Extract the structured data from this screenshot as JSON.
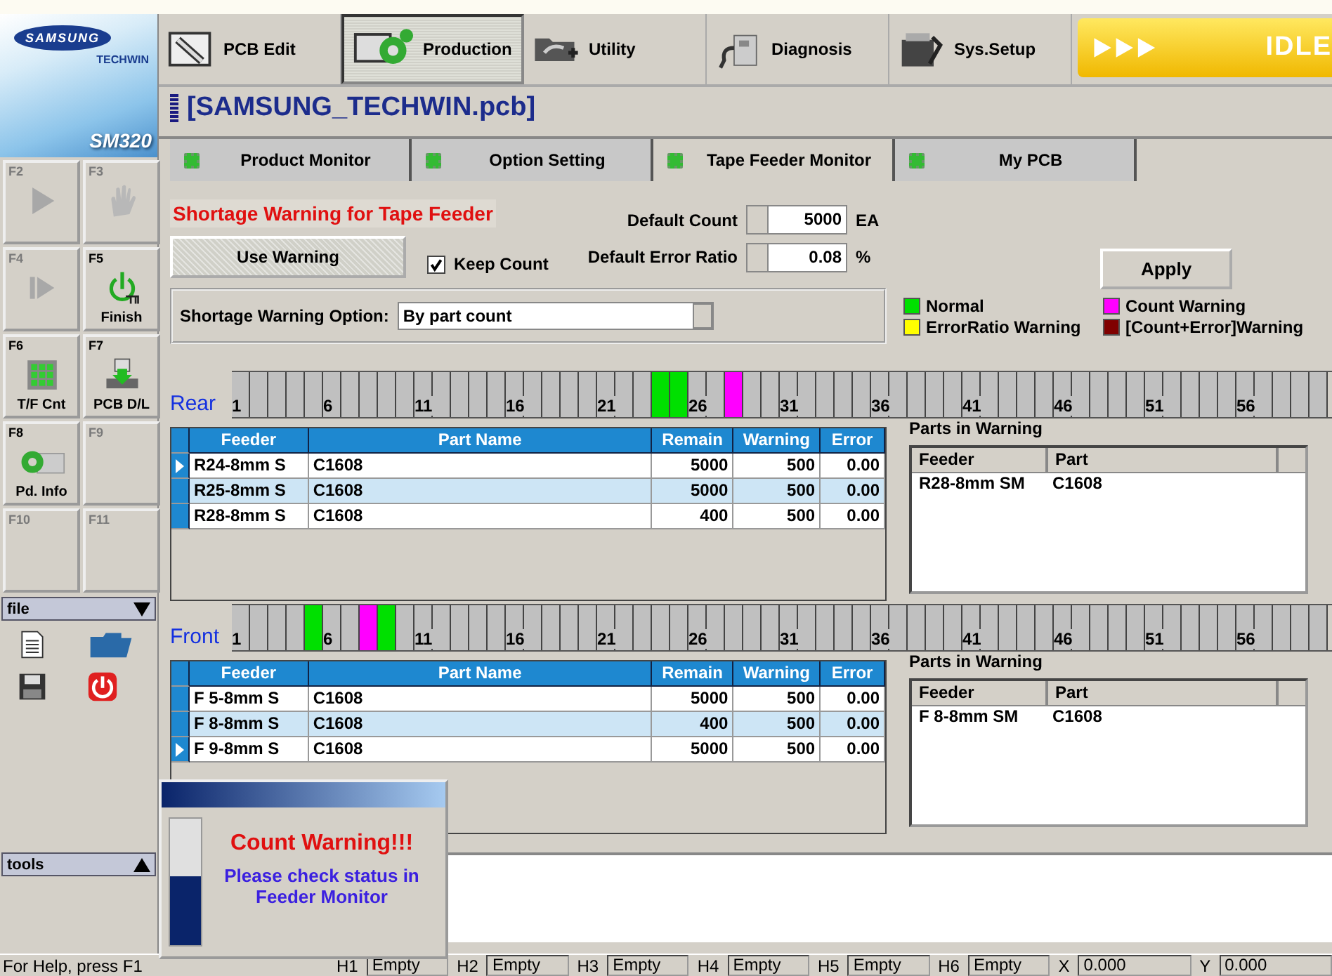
{
  "logo": {
    "brand": "SAMSUNG",
    "sub": "TECHWIN",
    "model": "SM320"
  },
  "function_keys": [
    {
      "key": "F2",
      "kind": "play",
      "enabled": false
    },
    {
      "key": "F3",
      "kind": "hand",
      "enabled": false
    },
    {
      "key": "F4",
      "kind": "step",
      "enabled": false
    },
    {
      "key": "F5",
      "kind": "finish",
      "label": "Finish",
      "enabled": true
    },
    {
      "key": "F6",
      "kind": "grid",
      "label": "T/F Cnt",
      "enabled": true
    },
    {
      "key": "F7",
      "kind": "download",
      "label": "PCB D/L",
      "enabled": true
    },
    {
      "key": "F8",
      "kind": "gear",
      "label": "Pd. Info",
      "enabled": true
    },
    {
      "key": "F9",
      "kind": "none",
      "enabled": false
    },
    {
      "key": "F10",
      "kind": "none",
      "enabled": false
    },
    {
      "key": "F11",
      "kind": "none",
      "enabled": false
    }
  ],
  "file_panel": {
    "title": "file",
    "expanded": true
  },
  "tools_panel": {
    "title": "tools",
    "expanded": false
  },
  "menu": [
    {
      "label": "PCB Edit",
      "kind": "pcb-edit",
      "selected": false
    },
    {
      "label": "Production",
      "kind": "production",
      "selected": true
    },
    {
      "label": "Utility",
      "kind": "utility",
      "selected": false
    },
    {
      "label": "Diagnosis",
      "kind": "diagnosis",
      "selected": false
    },
    {
      "label": "Sys.Setup",
      "kind": "sys-setup",
      "selected": false
    }
  ],
  "machine_status": "IDLE",
  "title": "[SAMSUNG_TECHWIN.pcb]",
  "tabs": [
    {
      "label": "Product Monitor",
      "selected": false
    },
    {
      "label": "Option Setting",
      "selected": false
    },
    {
      "label": "Tape Feeder Monitor",
      "selected": true
    },
    {
      "label": "My PCB",
      "selected": false
    }
  ],
  "settings": {
    "heading": "Shortage Warning for Tape Feeder",
    "use_warning": {
      "label": "Use Warning",
      "pressed": true
    },
    "keep_count": {
      "label": "Keep Count",
      "checked": true
    },
    "default_count": {
      "label": "Default Count",
      "value": "5000",
      "unit": "EA"
    },
    "default_error_ratio": {
      "label": "Default Error Ratio",
      "value": "0.08",
      "unit": "%"
    },
    "option": {
      "label": "Shortage Warning Option:",
      "value": "By part count"
    },
    "apply": "Apply",
    "legend": [
      {
        "label": "Normal",
        "kind": "normal",
        "color": "#00e000"
      },
      {
        "label": "Count Warning",
        "kind": "count",
        "color": "#ff00ff"
      },
      {
        "label": "ErrorRatio Warning",
        "kind": "error_ratio",
        "color": "#ffff00"
      },
      {
        "label": "[Count+Error]Warning",
        "kind": "count_error",
        "color": "#800000"
      }
    ]
  },
  "banks": [
    {
      "label": "Rear",
      "slots": [
        {
          "label": "1",
          "kind": "empty"
        },
        {
          "kind": "empty"
        },
        {
          "kind": "empty"
        },
        {
          "kind": "empty"
        },
        {
          "kind": "empty"
        },
        {
          "label": "6",
          "kind": "empty"
        },
        {
          "kind": "empty"
        },
        {
          "kind": "empty"
        },
        {
          "kind": "empty"
        },
        {
          "kind": "empty"
        },
        {
          "label": "11",
          "kind": "empty"
        },
        {
          "kind": "empty"
        },
        {
          "kind": "empty"
        },
        {
          "kind": "empty"
        },
        {
          "kind": "empty"
        },
        {
          "label": "16",
          "kind": "empty"
        },
        {
          "kind": "empty"
        },
        {
          "kind": "empty"
        },
        {
          "kind": "empty"
        },
        {
          "kind": "empty"
        },
        {
          "label": "21",
          "kind": "empty"
        },
        {
          "kind": "empty"
        },
        {
          "kind": "empty"
        },
        {
          "kind": "normal"
        },
        {
          "kind": "normal"
        },
        {
          "label": "26",
          "kind": "empty"
        },
        {
          "kind": "empty"
        },
        {
          "kind": "count"
        },
        {
          "kind": "empty"
        },
        {
          "kind": "empty"
        },
        {
          "label": "31",
          "kind": "empty"
        },
        {
          "kind": "empty"
        },
        {
          "kind": "empty"
        },
        {
          "kind": "empty"
        },
        {
          "kind": "empty"
        },
        {
          "label": "36",
          "kind": "empty"
        },
        {
          "kind": "empty"
        },
        {
          "kind": "empty"
        },
        {
          "kind": "empty"
        },
        {
          "kind": "empty"
        },
        {
          "label": "41",
          "kind": "empty"
        },
        {
          "kind": "empty"
        },
        {
          "kind": "empty"
        },
        {
          "kind": "empty"
        },
        {
          "kind": "empty"
        },
        {
          "label": "46",
          "kind": "empty"
        },
        {
          "kind": "empty"
        },
        {
          "kind": "empty"
        },
        {
          "kind": "empty"
        },
        {
          "kind": "empty"
        },
        {
          "label": "51",
          "kind": "empty"
        },
        {
          "kind": "empty"
        },
        {
          "kind": "empty"
        },
        {
          "kind": "empty"
        },
        {
          "kind": "empty"
        },
        {
          "label": "56",
          "kind": "empty"
        },
        {
          "kind": "empty"
        },
        {
          "kind": "empty"
        },
        {
          "kind": "empty"
        },
        {
          "kind": "empty"
        }
      ],
      "table": {
        "columns": [
          "Feeder",
          "Part Name",
          "Remain",
          "Warning",
          "Error"
        ],
        "rows": [
          {
            "selected": true,
            "cells": [
              "R24-8mm S",
              "C1608",
              "5000",
              "500",
              "0.00"
            ]
          },
          {
            "selected": false,
            "cells": [
              "R25-8mm S",
              "C1608",
              "5000",
              "500",
              "0.00"
            ]
          },
          {
            "selected": false,
            "cells": [
              "R28-8mm S",
              "C1608",
              "400",
              "500",
              "0.00"
            ]
          }
        ]
      },
      "parts_in_warning": {
        "title": "Parts in Warning",
        "columns": [
          "Feeder",
          "Part"
        ],
        "rows": [
          [
            "R28-8mm SM",
            "C1608"
          ]
        ]
      }
    },
    {
      "label": "Front",
      "slots": [
        {
          "label": "1",
          "kind": "empty"
        },
        {
          "kind": "empty"
        },
        {
          "kind": "empty"
        },
        {
          "kind": "empty"
        },
        {
          "kind": "normal"
        },
        {
          "label": "6",
          "kind": "empty"
        },
        {
          "kind": "empty"
        },
        {
          "kind": "count"
        },
        {
          "kind": "normal"
        },
        {
          "kind": "empty"
        },
        {
          "label": "11",
          "kind": "empty"
        },
        {
          "kind": "empty"
        },
        {
          "kind": "empty"
        },
        {
          "kind": "empty"
        },
        {
          "kind": "empty"
        },
        {
          "label": "16",
          "kind": "empty"
        },
        {
          "kind": "empty"
        },
        {
          "kind": "empty"
        },
        {
          "kind": "empty"
        },
        {
          "kind": "empty"
        },
        {
          "label": "21",
          "kind": "empty"
        },
        {
          "kind": "empty"
        },
        {
          "kind": "empty"
        },
        {
          "kind": "empty"
        },
        {
          "kind": "empty"
        },
        {
          "label": "26",
          "kind": "empty"
        },
        {
          "kind": "empty"
        },
        {
          "kind": "empty"
        },
        {
          "kind": "empty"
        },
        {
          "kind": "empty"
        },
        {
          "label": "31",
          "kind": "empty"
        },
        {
          "kind": "empty"
        },
        {
          "kind": "empty"
        },
        {
          "kind": "empty"
        },
        {
          "kind": "empty"
        },
        {
          "label": "36",
          "kind": "empty"
        },
        {
          "kind": "empty"
        },
        {
          "kind": "empty"
        },
        {
          "kind": "empty"
        },
        {
          "kind": "empty"
        },
        {
          "label": "41",
          "kind": "empty"
        },
        {
          "kind": "empty"
        },
        {
          "kind": "empty"
        },
        {
          "kind": "empty"
        },
        {
          "kind": "empty"
        },
        {
          "label": "46",
          "kind": "empty"
        },
        {
          "kind": "empty"
        },
        {
          "kind": "empty"
        },
        {
          "kind": "empty"
        },
        {
          "kind": "empty"
        },
        {
          "label": "51",
          "kind": "empty"
        },
        {
          "kind": "empty"
        },
        {
          "kind": "empty"
        },
        {
          "kind": "empty"
        },
        {
          "kind": "empty"
        },
        {
          "label": "56",
          "kind": "empty"
        },
        {
          "kind": "empty"
        },
        {
          "kind": "empty"
        },
        {
          "kind": "empty"
        },
        {
          "kind": "empty"
        }
      ],
      "table": {
        "columns": [
          "Feeder",
          "Part Name",
          "Remain",
          "Warning",
          "Error"
        ],
        "rows": [
          {
            "selected": false,
            "cells": [
              "F 5-8mm S",
              "C1608",
              "5000",
              "500",
              "0.00"
            ]
          },
          {
            "selected": false,
            "cells": [
              "F 8-8mm S",
              "C1608",
              "400",
              "500",
              "0.00"
            ]
          },
          {
            "selected": true,
            "cells": [
              "F 9-8mm S",
              "C1608",
              "5000",
              "500",
              "0.00"
            ]
          }
        ]
      },
      "parts_in_warning": {
        "title": "Parts in Warning",
        "columns": [
          "Feeder",
          "Part"
        ],
        "rows": [
          [
            "F 8-8mm SM",
            "C1608"
          ]
        ]
      }
    }
  ],
  "popup": {
    "level": 0.55,
    "title": "Count Warning!!!",
    "message": "Please check status in Feeder Monitor"
  },
  "status_bar": {
    "help": "For Help, press F1",
    "heads": [
      {
        "label": "H1",
        "value": "Empty"
      },
      {
        "label": "H2",
        "value": "Empty"
      },
      {
        "label": "H3",
        "value": "Empty"
      },
      {
        "label": "H4",
        "value": "Empty"
      },
      {
        "label": "H5",
        "value": "Empty"
      },
      {
        "label": "H6",
        "value": "Empty"
      }
    ],
    "coords": [
      {
        "label": "X",
        "value": "0.000"
      },
      {
        "label": "Y",
        "value": "0.000"
      }
    ]
  }
}
